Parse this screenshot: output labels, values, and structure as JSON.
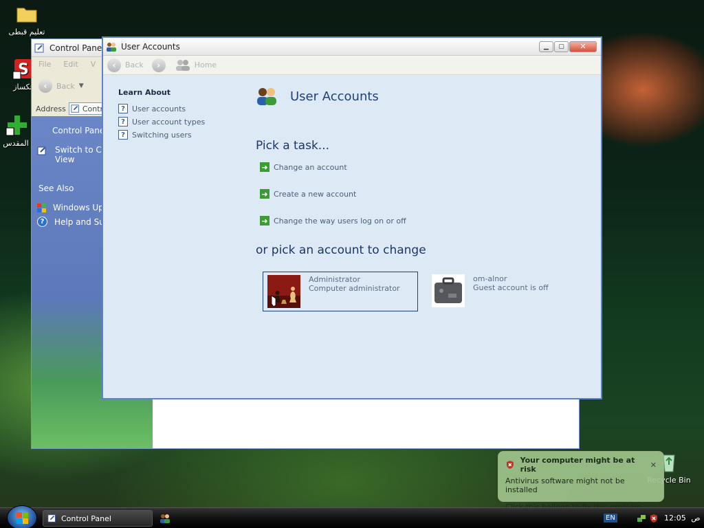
{
  "desktop": {
    "icons": [
      {
        "label": "تعليم قبطى"
      },
      {
        "label": "تكساز"
      },
      {
        "label": "المقدس"
      },
      {
        "label": "Recycle Bin"
      }
    ]
  },
  "cp_window": {
    "title": "Control Panel",
    "menu": [
      "File",
      "Edit",
      "V"
    ],
    "back_label": "Back",
    "address_label": "Address",
    "address_value": "Contr",
    "sidebar_title": "Control Pane",
    "switch_label_1": "Switch to C",
    "switch_label_2": "View",
    "see_also": "See Also",
    "links": [
      "Windows Up",
      "Help and Sup"
    ]
  },
  "ua_window": {
    "title": "User Accounts",
    "nav": {
      "back": "Back",
      "home": "Home"
    },
    "learn_about": {
      "title": "Learn About",
      "links": [
        "User accounts",
        "User account types",
        "Switching users"
      ]
    },
    "heading": "User Accounts",
    "pick_task": "Pick a task...",
    "tasks": [
      "Change an account",
      "Create a new account",
      "Change the way users log on or off"
    ],
    "pick_account": "or pick an account to change",
    "accounts": [
      {
        "name": "Administrator",
        "type": "Computer administrator"
      },
      {
        "name": "om-alnor",
        "type": "Guest account is off"
      }
    ]
  },
  "balloon": {
    "title": "Your computer might be at risk",
    "line1": "Antivirus software might not be installed",
    "line2": "Click this balloon to fix this problem."
  },
  "taskbar": {
    "task_label": "Control Panel",
    "lang": "EN",
    "ampm": "ص",
    "clock": "12:05"
  },
  "colors": {
    "accent": "#21407a",
    "link": "#4b5d78",
    "pane": "#dde9f4",
    "taskbar": "#111111"
  }
}
